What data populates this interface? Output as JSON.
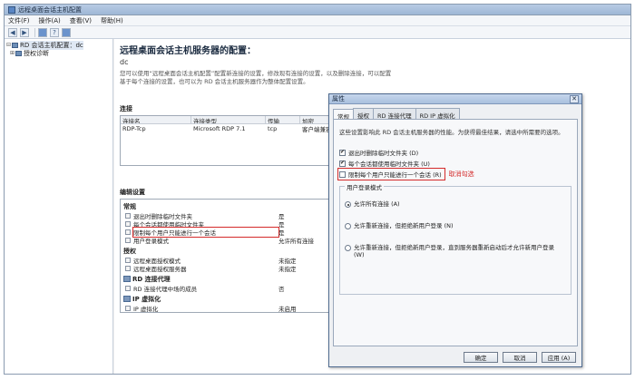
{
  "window": {
    "title": "远程桌面会话主机配置"
  },
  "menu": {
    "items": [
      "文件(F)",
      "操作(A)",
      "查看(V)",
      "帮助(H)"
    ]
  },
  "tree": {
    "root": "RD 会话主机配置：dc",
    "child": "授权诊断"
  },
  "main": {
    "title": "远程桌面会话主机服务器的配置：",
    "server": "dc",
    "description": "您可以使用“远程桌面会话主机配置”配置新连接的设置，修改现有连接的设置，以及删除连接，可以配置基于每个连接的设置，也可以为 RD 会话主机服务器作为整体配置设置。"
  },
  "connections": {
    "section_title": "连接",
    "columns": [
      "连接名",
      "连接类型",
      "传输",
      "加密"
    ],
    "rows": [
      {
        "name": "RDP-Tcp",
        "type": "Microsoft RDP 7.1",
        "transport": "tcp",
        "encryption": "客户端兼容"
      }
    ]
  },
  "edit_settings": {
    "section_title": "编辑设置",
    "groups": [
      {
        "name": "常规",
        "settings": [
          {
            "name": "退出时删除临时文件夹",
            "value": "是"
          },
          {
            "name": "每个会话都使用临时文件夹",
            "value": "是"
          },
          {
            "name": "限制每个用户只能进行一个会话",
            "value": "是"
          },
          {
            "name": "用户登录模式",
            "value": "允许所有连接"
          }
        ]
      },
      {
        "name": "授权",
        "settings": [
          {
            "name": "远程桌面授权模式",
            "value": "未指定"
          },
          {
            "name": "远程桌面授权服务器",
            "value": "未指定"
          }
        ]
      },
      {
        "name": "RD 连接代理",
        "settings": [
          {
            "name": "RD 连接代理中场的成员",
            "value": "否"
          }
        ]
      },
      {
        "name": "IP 虚拟化",
        "settings": [
          {
            "name": "IP 虚拟化",
            "value": "未启用"
          }
        ]
      }
    ]
  },
  "dialog": {
    "title": "属性",
    "close_glyph": "✕",
    "tabs": [
      "常规",
      "授权",
      "RD 连接代理",
      "RD IP 虚拟化"
    ],
    "description": "这些设置影响此 RD 会话主机服务器的性能。为获得最佳结果，请选中所需要的选项。",
    "checkboxes": [
      {
        "label": "退出时删除临时文件夹 (D)",
        "checked": true
      },
      {
        "label": "每个会话都使用临时文件夹 (U)",
        "checked": true
      },
      {
        "label": "限制每个用户只能进行一个会话 (R)",
        "checked": false
      }
    ],
    "annotation": "取消勾选",
    "login_mode": {
      "title": "用户登录模式",
      "options": [
        {
          "label": "允许所有连接 (A)",
          "selected": true
        },
        {
          "label": "允许重新连接，但拒绝新用户登录 (N)",
          "selected": false
        },
        {
          "label": "允许重新连接，但拒绝新用户登录，直到服务器重新启动后才允许新用户登录 (W)",
          "selected": false
        }
      ]
    },
    "buttons": {
      "ok": "确定",
      "cancel": "取消",
      "apply": "应用 (A)"
    }
  }
}
